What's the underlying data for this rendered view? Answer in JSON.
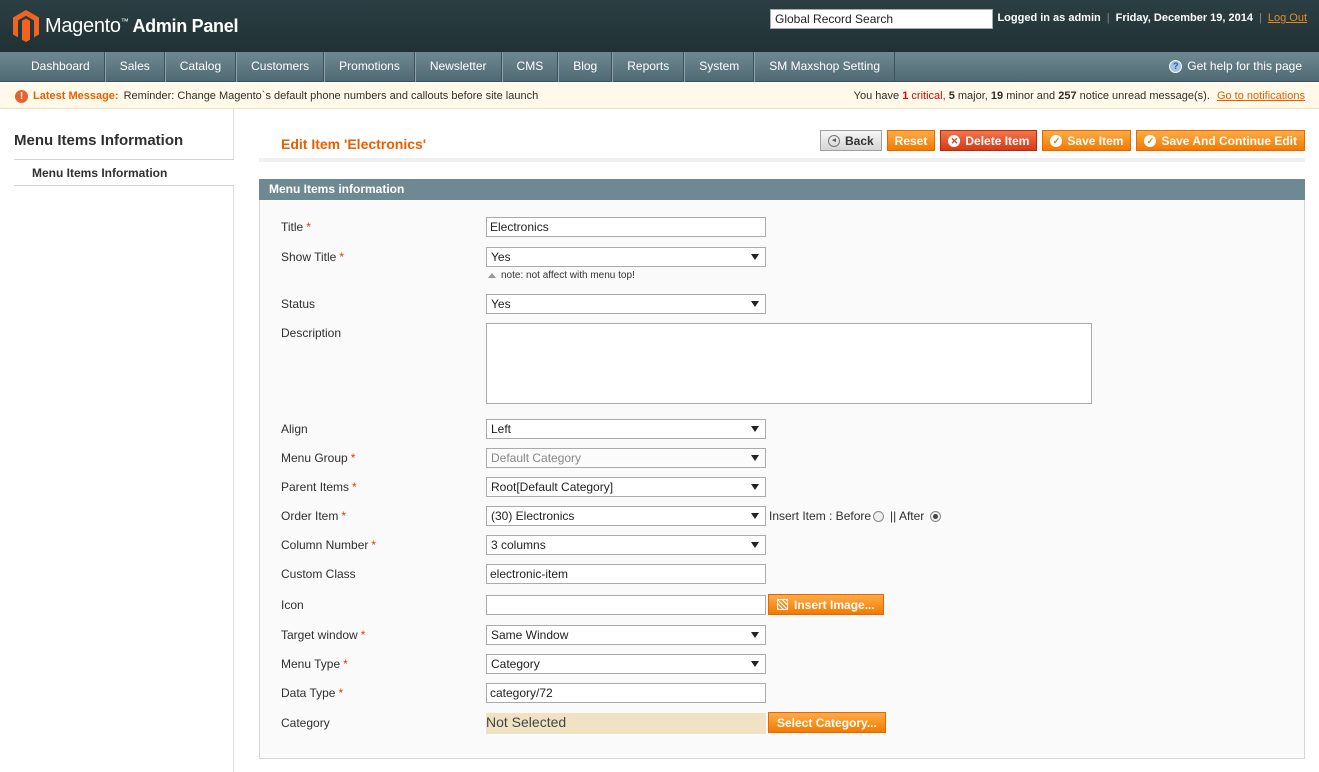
{
  "header": {
    "logo_main": "Magento",
    "logo_tm": "™",
    "logo_sub": "Admin Panel",
    "search_value": "Global Record Search",
    "logged_in": "Logged in as admin",
    "date": "Friday, December 19, 2014",
    "logout": "Log Out",
    "separator": "|"
  },
  "nav": {
    "items": [
      "Dashboard",
      "Sales",
      "Catalog",
      "Customers",
      "Promotions",
      "Newsletter",
      "CMS",
      "Blog",
      "Reports",
      "System",
      "SM Maxshop Setting"
    ],
    "help": "Get help for this page",
    "help_icon_glyph": "?"
  },
  "message": {
    "icon_glyph": "!",
    "label": "Latest Message:",
    "text": "Reminder: Change Magento`s default phone numbers and callouts before site launch",
    "counts_prefix": "You have",
    "critical_count": "1",
    "critical_label": "critical,",
    "major_count": "5",
    "major_label": "major,",
    "minor_count": "19",
    "minor_label": "minor and",
    "notice_count": "257",
    "notice_label": "notice unread message(s).",
    "goto": "Go to notifications"
  },
  "sidebar": {
    "title": "Menu Items Information",
    "tab": "Menu Items Information"
  },
  "page": {
    "title": "Edit Item 'Electronics'",
    "buttons": {
      "back": "Back",
      "reset": "Reset",
      "delete": "Delete Item",
      "save": "Save Item",
      "save_continue": "Save And Continue Edit"
    },
    "icons": {
      "back": "◂",
      "delete": "✕",
      "save": "✓"
    }
  },
  "form": {
    "legend": "Menu Items information",
    "required_mark": "*",
    "title_label": "Title",
    "title_value": "Electronics",
    "show_title_label": "Show Title",
    "show_title_value": "Yes",
    "show_title_note": "note: not affect with menu top!",
    "status_label": "Status",
    "status_value": "Yes",
    "description_label": "Description",
    "description_value": "",
    "align_label": "Align",
    "align_value": "Left",
    "menu_group_label": "Menu Group",
    "menu_group_value": "Default Category",
    "parent_label": "Parent Items",
    "parent_value": "Root[Default Category]",
    "order_label": "Order Item",
    "order_value": "(30) Electronics",
    "insert_label": "Insert Item : Before",
    "insert_sep": "|| After",
    "insert_selected": "After",
    "column_label": "Column Number",
    "column_value": "3 columns",
    "custom_class_label": "Custom Class",
    "custom_class_value": "electronic-item",
    "icon_label": "Icon",
    "icon_value": "",
    "insert_image": "Insert Image...",
    "target_label": "Target window",
    "target_value": "Same Window",
    "menu_type_label": "Menu Type",
    "menu_type_value": "Category",
    "data_type_label": "Data Type",
    "data_type_value": "category/72",
    "category_label": "Category",
    "category_value": "Not Selected",
    "select_category": "Select Category..."
  }
}
